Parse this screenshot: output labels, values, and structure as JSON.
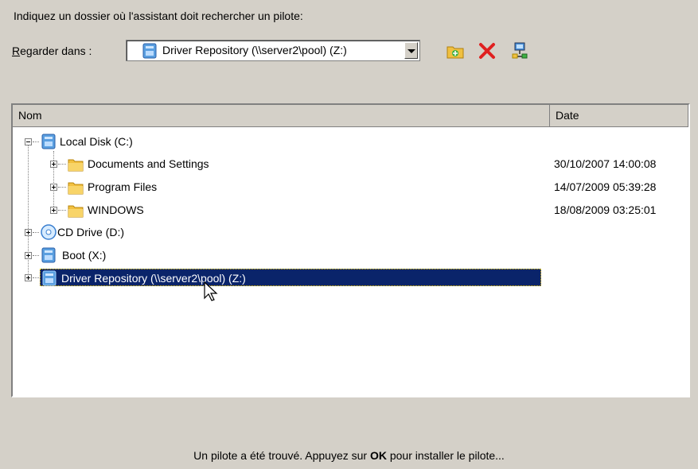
{
  "instruction": "Indiquez un dossier où l'assistant doit rechercher un pilote:",
  "lookin": {
    "label_underlined": "R",
    "label_rest": "egarder dans :",
    "value": "Driver Repository (\\\\server2\\pool) (Z:)"
  },
  "toolbar": {
    "icons": [
      "new-folder-icon",
      "delete-icon",
      "map-network-drive-icon"
    ]
  },
  "columns": [
    "Nom",
    "Date"
  ],
  "tree": [
    {
      "label": "Local Disk (C:)",
      "icon": "hard-drive-icon",
      "date": "",
      "level": 0,
      "expanded": true,
      "selected": false
    },
    {
      "label": "Documents and Settings",
      "icon": "folder-icon",
      "date": "30/10/2007 14:00:08",
      "level": 1,
      "expanded": false,
      "selected": false
    },
    {
      "label": "Program Files",
      "icon": "folder-icon",
      "date": "14/07/2009 05:39:28",
      "level": 1,
      "expanded": false,
      "selected": false
    },
    {
      "label": "WINDOWS",
      "icon": "folder-icon",
      "date": "18/08/2009 03:25:01",
      "level": 1,
      "expanded": false,
      "selected": false
    },
    {
      "label": "CD Drive (D:)",
      "icon": "cd-drive-icon",
      "date": "",
      "level": 0,
      "expanded": false,
      "selected": false
    },
    {
      "label": "Boot (X:)",
      "icon": "hard-drive-icon",
      "date": "",
      "level": 0,
      "expanded": false,
      "selected": false
    },
    {
      "label": "Driver Repository (\\\\server2\\pool) (Z:)",
      "icon": "network-drive-icon",
      "date": "",
      "level": 0,
      "expanded": false,
      "selected": true
    }
  ],
  "status": {
    "before": "Un pilote a été trouvé. Appuyez sur ",
    "bold": "OK",
    "after": " pour installer le pilote..."
  }
}
